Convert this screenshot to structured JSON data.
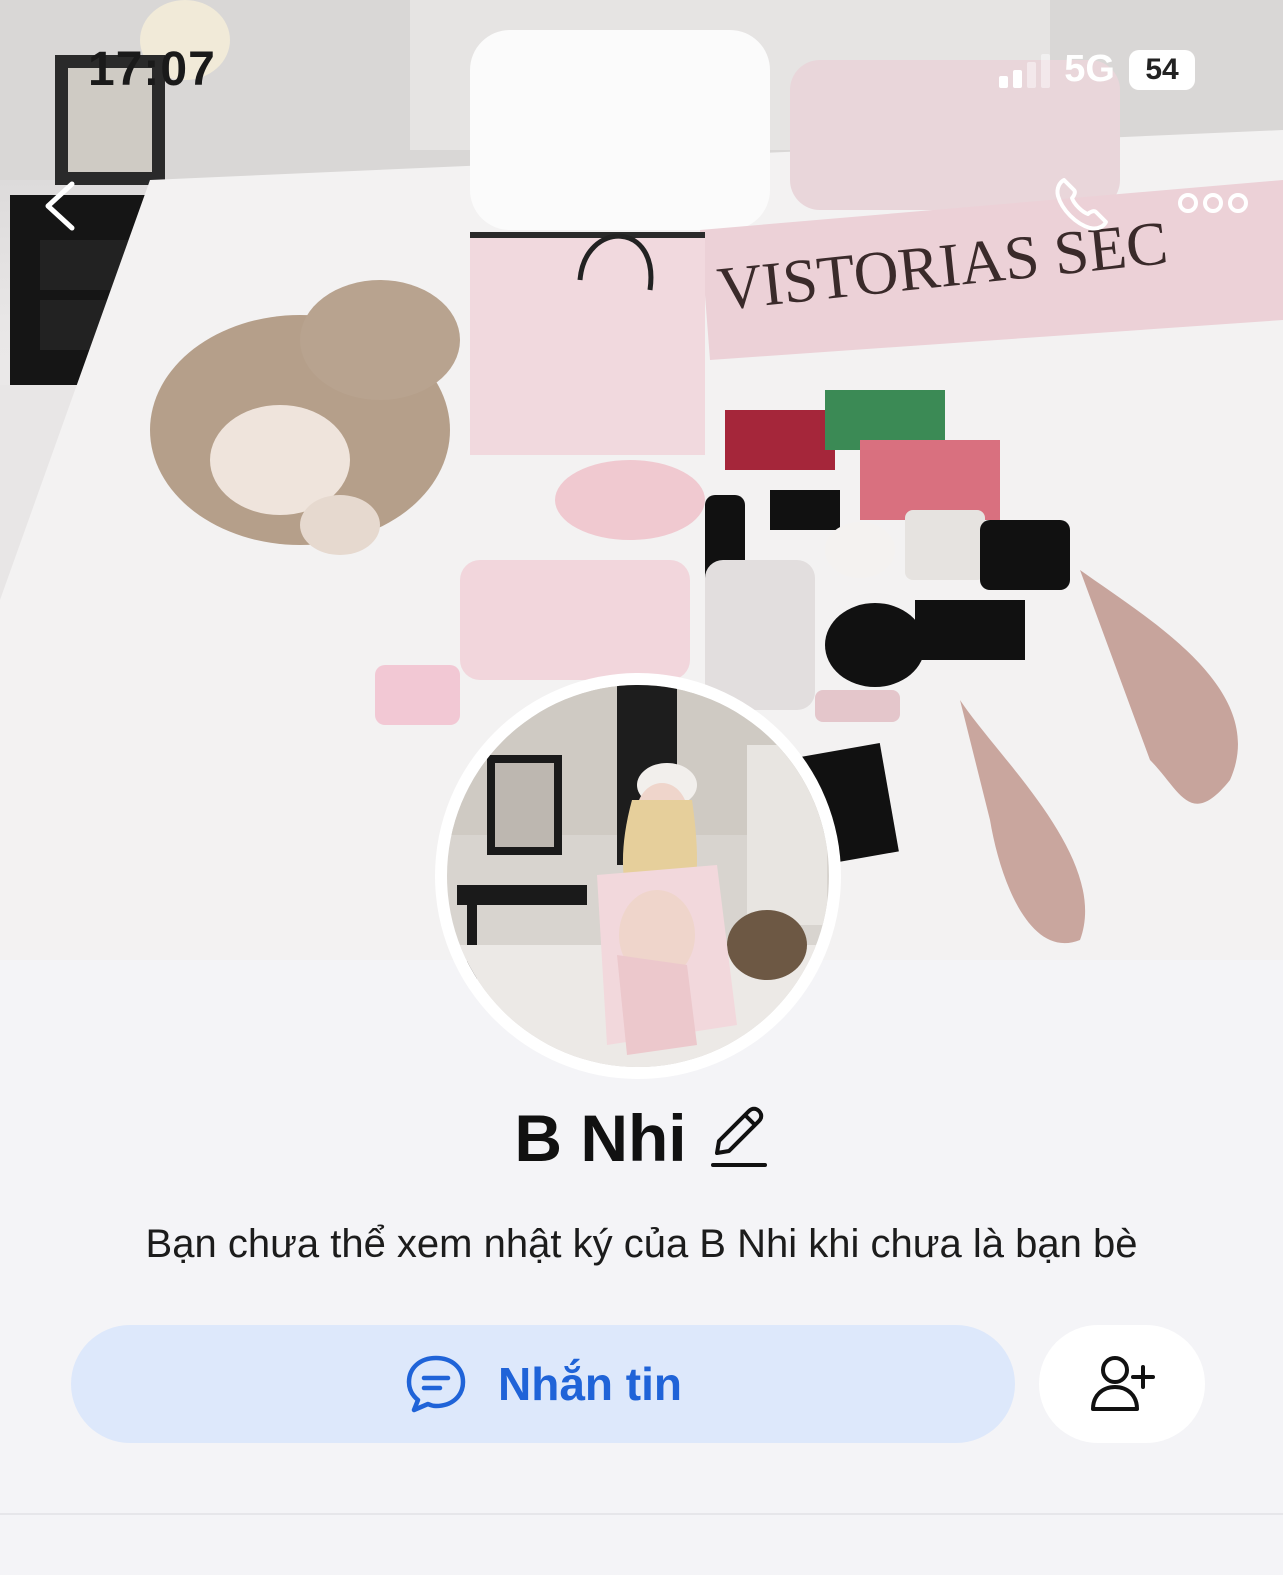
{
  "status_bar": {
    "time": "17:07",
    "network": "5G",
    "battery": "54"
  },
  "cover": {
    "banner_text": "VISTORIAS SEC"
  },
  "profile": {
    "name": "B Nhi",
    "notice": "Bạn chưa thể xem nhật ký của B Nhi khi chưa là bạn bè"
  },
  "actions": {
    "message_label": "Nhắn tin"
  },
  "colors": {
    "accent": "#1f63d8",
    "message_button_bg": "#dde8fb",
    "page_bg": "#f4f4f7"
  },
  "icons": {
    "back": "chevron-left-icon",
    "call": "phone-icon",
    "more": "more-horizontal-icon",
    "edit": "pencil-icon",
    "message": "chat-bubble-icon",
    "add_friend": "add-user-icon"
  }
}
